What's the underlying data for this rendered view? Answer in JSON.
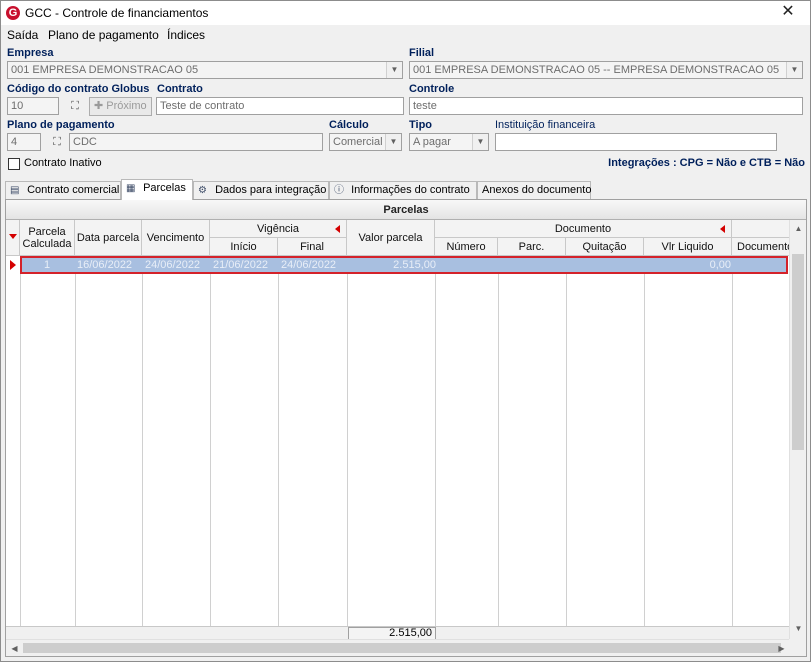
{
  "window": {
    "title": "GCC - Controle de financiamentos",
    "logo_letter": "G",
    "close_glyph": "✕"
  },
  "menu": {
    "items": [
      "Saída",
      "Plano de pagamento",
      "Índices"
    ]
  },
  "form": {
    "empresa_label": "Empresa",
    "empresa_value": "001 EMPRESA DEMONSTRACAO 05",
    "filial_label": "Filial",
    "filial_value": "001 EMPRESA DEMONSTRACAO 05 -- EMPRESA DEMONSTRACAO 05",
    "codigo_label": "Código do contrato Globus",
    "codigo_value": "10",
    "proximo_label": "Próximo",
    "contrato_label": "Contrato",
    "contrato_value": "Teste de contrato",
    "controle_label": "Controle",
    "controle_value": "teste",
    "plano_label": "Plano de pagamento",
    "plano_code": "4",
    "plano_name": "CDC",
    "calculo_label": "Cálculo",
    "calculo_value": "Comercial",
    "tipo_label": "Tipo",
    "tipo_value": "A pagar",
    "instituicao_label": "Instituição financeira",
    "instituicao_value": "",
    "inativo_label": "Contrato Inativo",
    "integracoes": "Integrações : CPG = Não e CTB = Não"
  },
  "tabs": [
    {
      "label": "Contrato comercial"
    },
    {
      "label": "Parcelas"
    },
    {
      "label": "Dados para integração"
    },
    {
      "label": "Informações do contrato"
    },
    {
      "label": "Anexos do documento"
    }
  ],
  "grid": {
    "title": "Parcelas",
    "headers": {
      "parcela_calculada": "Parcela Calculada",
      "data_parcela": "Data parcela",
      "vencimento": "Vencimento",
      "vigencia": "Vigência",
      "inicio": "Início",
      "final": "Final",
      "valor_parcela": "Valor parcela",
      "documento_group": "Documento",
      "numero": "Número",
      "parc": "Parc.",
      "quitacao": "Quitação",
      "vlr_liquido": "Vlr Liquido",
      "documento": "Documento"
    },
    "rows": [
      {
        "parcela": "1",
        "data_parcela": "16/06/2022",
        "vencimento": "24/06/2022",
        "inicio": "21/06/2022",
        "final": "24/06/2022",
        "valor_parcela": "2.515,00",
        "numero": "",
        "parc": "",
        "quitacao": "",
        "vlr_liquido": "0,00"
      }
    ],
    "total_valor_parcela": "2.515,00"
  }
}
